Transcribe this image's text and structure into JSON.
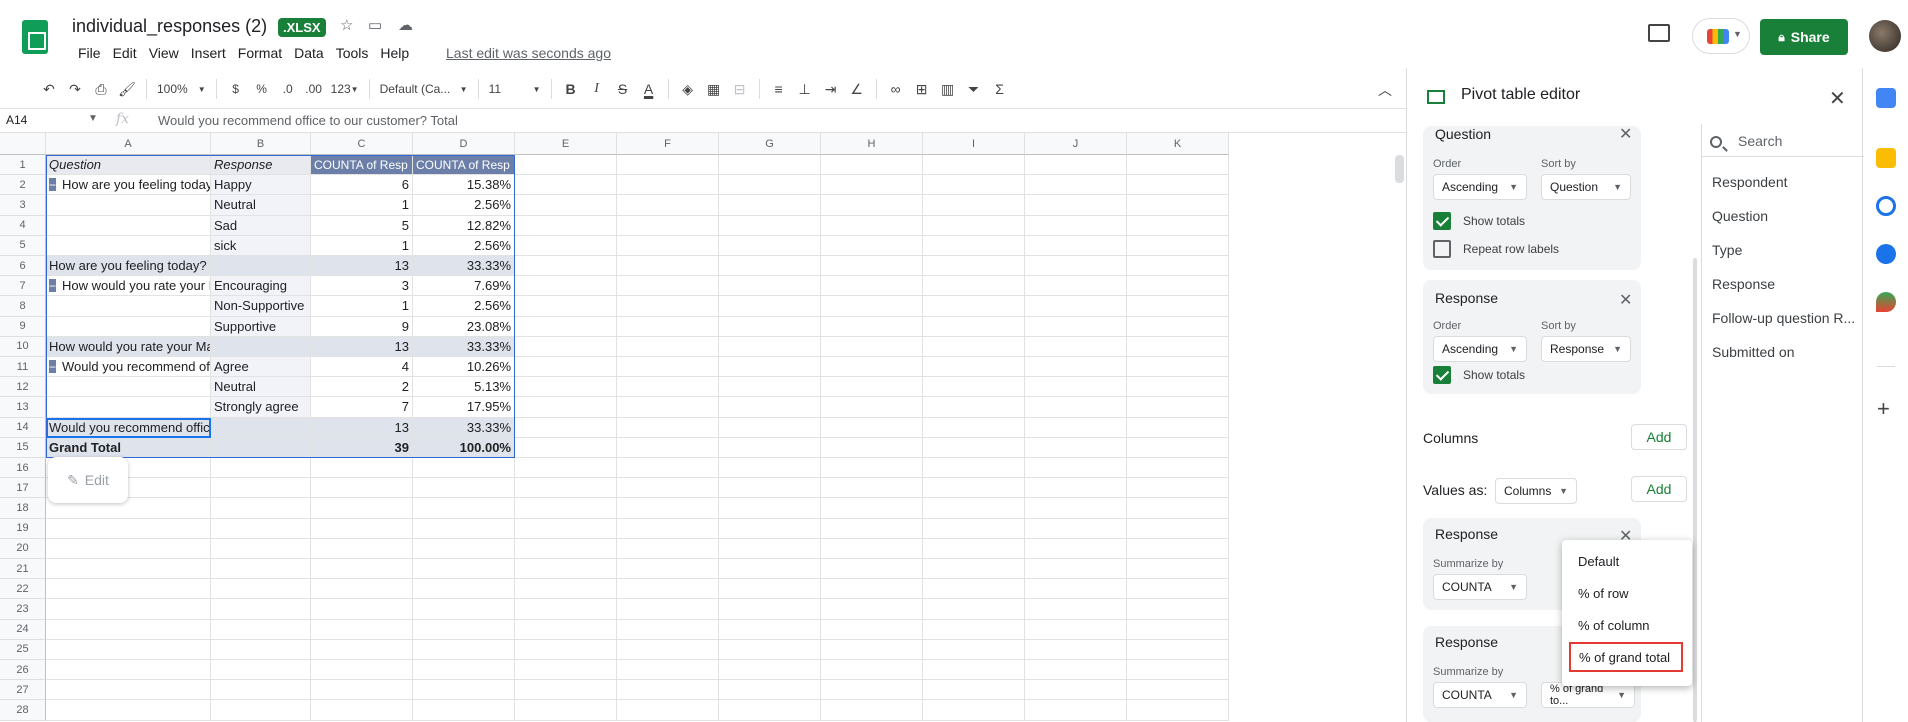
{
  "doc": {
    "title": "individual_responses (2)",
    "badge": ".XLSX",
    "last_edit": "Last edit was seconds ago",
    "menu": [
      "File",
      "Edit",
      "View",
      "Insert",
      "Format",
      "Data",
      "Tools",
      "Help"
    ],
    "share_label": "Share"
  },
  "toolbar": {
    "zoom": "100%",
    "currency": "$",
    "percent": "%",
    "dec_less": ".0",
    "dec_more": ".00",
    "format_more": "123",
    "font": "Default (Ca...",
    "size": "11",
    "bold": "B",
    "italic": "I",
    "strike": "S",
    "text_color": "A",
    "sum": "Σ"
  },
  "formula_bar": {
    "cell_ref": "A14",
    "fx": "fx",
    "content": "Would you recommend office to our customer? Total"
  },
  "columns": [
    "A",
    "B",
    "C",
    "D",
    "E",
    "F",
    "G",
    "H",
    "I",
    "J",
    "K"
  ],
  "rows": [
    "1",
    "2",
    "3",
    "4",
    "5",
    "6",
    "7",
    "8",
    "9",
    "10",
    "11",
    "12",
    "13",
    "14",
    "15",
    "16",
    "17",
    "18",
    "19",
    "20",
    "21",
    "22",
    "23",
    "24",
    "25",
    "26",
    "27",
    "28"
  ],
  "table": {
    "header": [
      "Question",
      "Response",
      "COUNTA of Resp",
      "COUNTA of Resp"
    ],
    "body": [
      {
        "kind": "first",
        "a": "How are you feeling today?",
        "b": "Happy",
        "c": "6",
        "d": "15.38%"
      },
      {
        "kind": "item",
        "a": "",
        "b": "Neutral",
        "c": "1",
        "d": "2.56%"
      },
      {
        "kind": "item",
        "a": "",
        "b": "Sad",
        "c": "5",
        "d": "12.82%"
      },
      {
        "kind": "item",
        "a": "",
        "b": "sick",
        "c": "1",
        "d": "2.56%"
      },
      {
        "kind": "total",
        "a": "How are you feeling today? Total",
        "b": "",
        "c": "13",
        "d": "33.33%"
      },
      {
        "kind": "first",
        "a": "How would you rate your Manager?",
        "b": "Encouraging",
        "c": "3",
        "d": "7.69%"
      },
      {
        "kind": "item",
        "a": "",
        "b": "Non-Supportive",
        "c": "1",
        "d": "2.56%"
      },
      {
        "kind": "item",
        "a": "",
        "b": "Supportive",
        "c": "9",
        "d": "23.08%"
      },
      {
        "kind": "total",
        "a": "How would you rate your Manager? Total",
        "b": "",
        "c": "13",
        "d": "33.33%"
      },
      {
        "kind": "first",
        "a": "Would you recommend office to our customer?",
        "b": "Agree",
        "c": "4",
        "d": "10.26%"
      },
      {
        "kind": "item",
        "a": "",
        "b": "Neutral",
        "c": "2",
        "d": "5.13%"
      },
      {
        "kind": "item",
        "a": "",
        "b": "Strongly agree",
        "c": "7",
        "d": "17.95%"
      },
      {
        "kind": "total",
        "a": "Would you recommend office to our customer? Total",
        "b": "",
        "c": "13",
        "d": "33.33%"
      },
      {
        "kind": "grand",
        "a": "Grand Total",
        "b": "",
        "c": "39",
        "d": "100.00%"
      }
    ]
  },
  "edit_chip": "Edit",
  "pivot": {
    "title": "Pivot table editor",
    "rows_card_question": {
      "title": "Question",
      "order_label": "Order",
      "order_value": "Ascending",
      "sortby_label": "Sort by",
      "sortby_value": "Question",
      "show_totals": "Show totals",
      "repeat_labels": "Repeat row labels"
    },
    "rows_card_response": {
      "title": "Response",
      "order_label": "Order",
      "order_value": "Ascending",
      "sortby_label": "Sort by",
      "sortby_value": "Response",
      "show_totals": "Show totals"
    },
    "columns_label": "Columns",
    "add": "Add",
    "values_as_label": "Values as:",
    "values_as_value": "Columns",
    "value_card_1": {
      "title": "Response",
      "summarize_label": "Summarize by",
      "summarize_value": "COUNTA"
    },
    "value_card_2": {
      "title": "Response",
      "summarize_label": "Summarize by",
      "summarize_value": "COUNTA",
      "show_as_value": "% of grand to..."
    },
    "menu": [
      "Default",
      "% of row",
      "% of column",
      "% of grand total"
    ],
    "search_placeholder": "Search",
    "fields": [
      "Respondent",
      "Question",
      "Type",
      "Response",
      "Follow-up question R...",
      "Submitted on"
    ]
  }
}
